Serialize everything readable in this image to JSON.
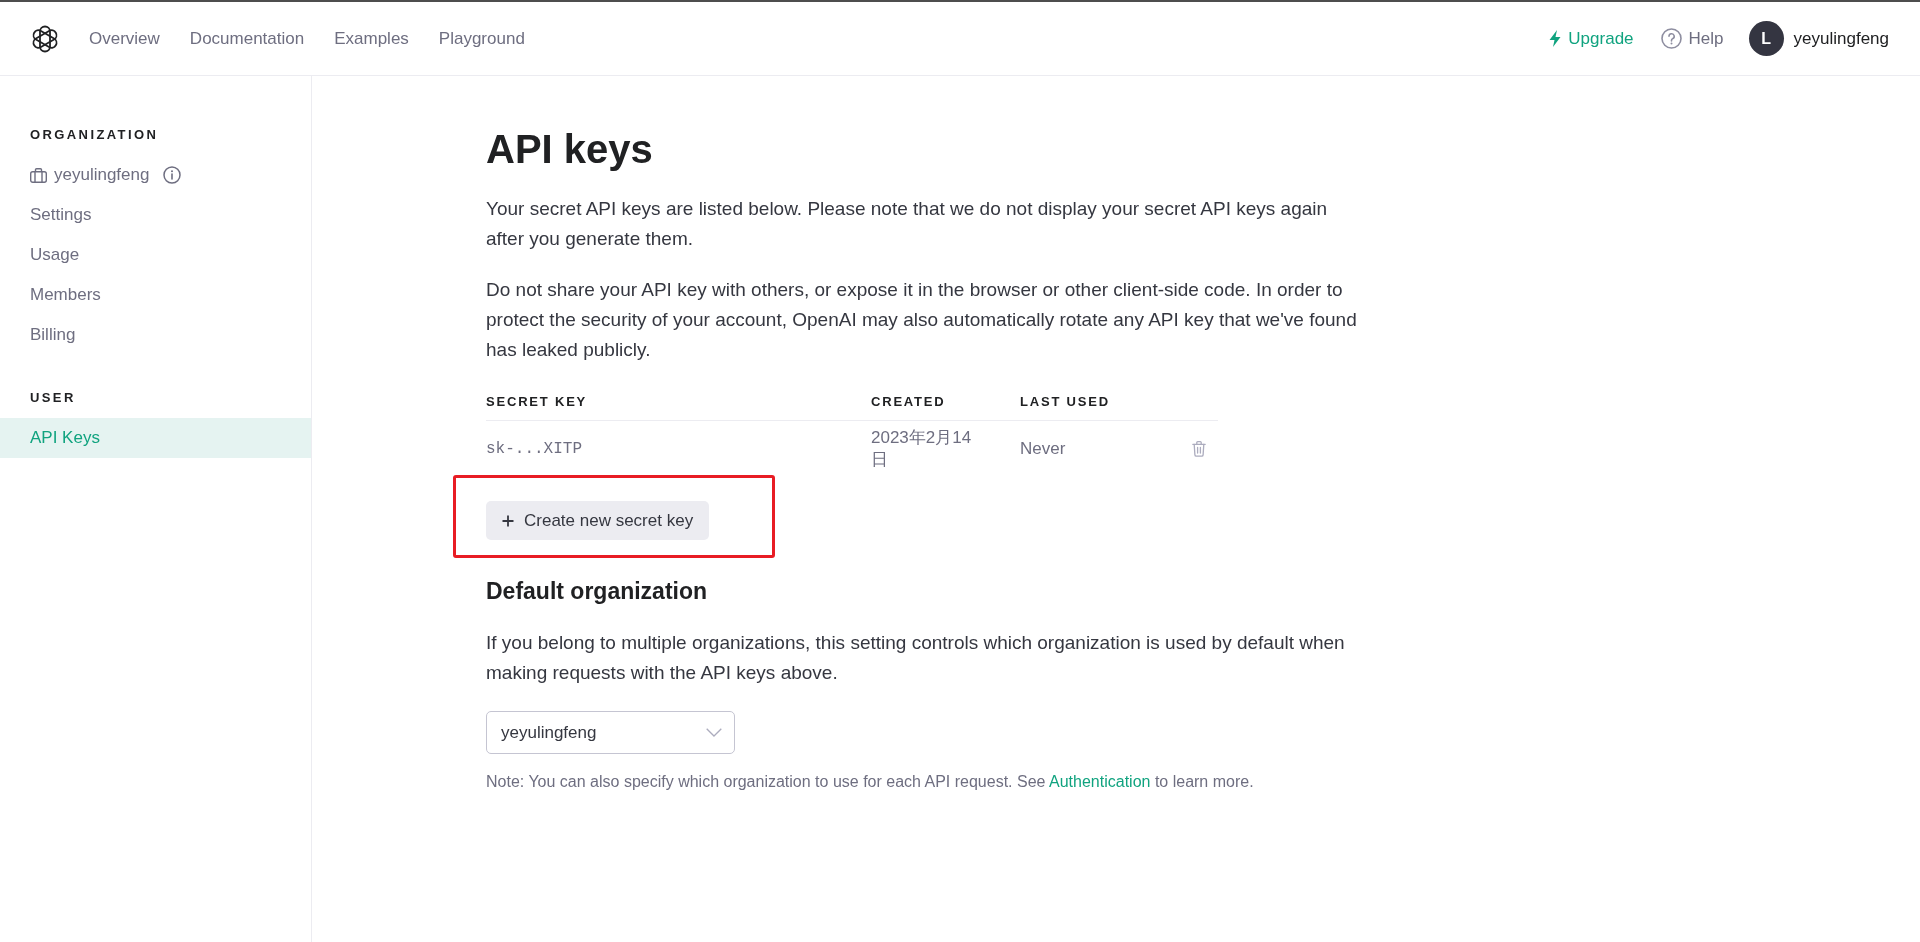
{
  "top_nav": {
    "links": [
      {
        "label": "Overview"
      },
      {
        "label": "Documentation"
      },
      {
        "label": "Examples"
      },
      {
        "label": "Playground"
      }
    ],
    "upgrade": {
      "label": "Upgrade"
    },
    "help": {
      "label": "Help"
    },
    "user": {
      "initial": "L",
      "name": "yeyulingfeng"
    }
  },
  "sidebar": {
    "sections": [
      {
        "heading": "ORGANIZATION",
        "items": [
          {
            "kind": "organization",
            "label": "yeyulingfeng",
            "selected": false
          },
          {
            "kind": "link",
            "label": "Settings",
            "selected": false
          },
          {
            "kind": "link",
            "label": "Usage",
            "selected": false
          },
          {
            "kind": "link",
            "label": "Members",
            "selected": false
          },
          {
            "kind": "link",
            "label": "Billing",
            "selected": false
          }
        ]
      },
      {
        "heading": "USER",
        "items": [
          {
            "kind": "link",
            "label": "API Keys",
            "selected": true
          }
        ]
      }
    ]
  },
  "main": {
    "title": "API keys",
    "intro": [
      "Your secret API keys are listed below. Please note that we do not display your secret API keys again after you generate them.",
      "Do not share your API key with others, or expose it in the browser or other client-side code. In order to protect the security of your account, OpenAI may also automatically rotate any API key that we've found has leaked publicly."
    ],
    "keys_table": {
      "columns": [
        "SECRET KEY",
        "CREATED",
        "LAST USED"
      ],
      "rows": [
        {
          "secret_key": "sk-...XITP",
          "created": "2023年2月14日",
          "last_used": "Never"
        }
      ]
    },
    "create_button": {
      "label": "Create new secret key",
      "highlighted": true
    },
    "default_organization": {
      "title": "Default organization",
      "description": "If you belong to multiple organizations, this setting controls which organization is used by default when making requests with the API keys above.",
      "select": {
        "value": "yeyulingfeng"
      },
      "note": {
        "before": "Note: You can also specify which organization to use for each API request. See ",
        "link": "Authentication",
        "after": " to learn more."
      }
    }
  }
}
